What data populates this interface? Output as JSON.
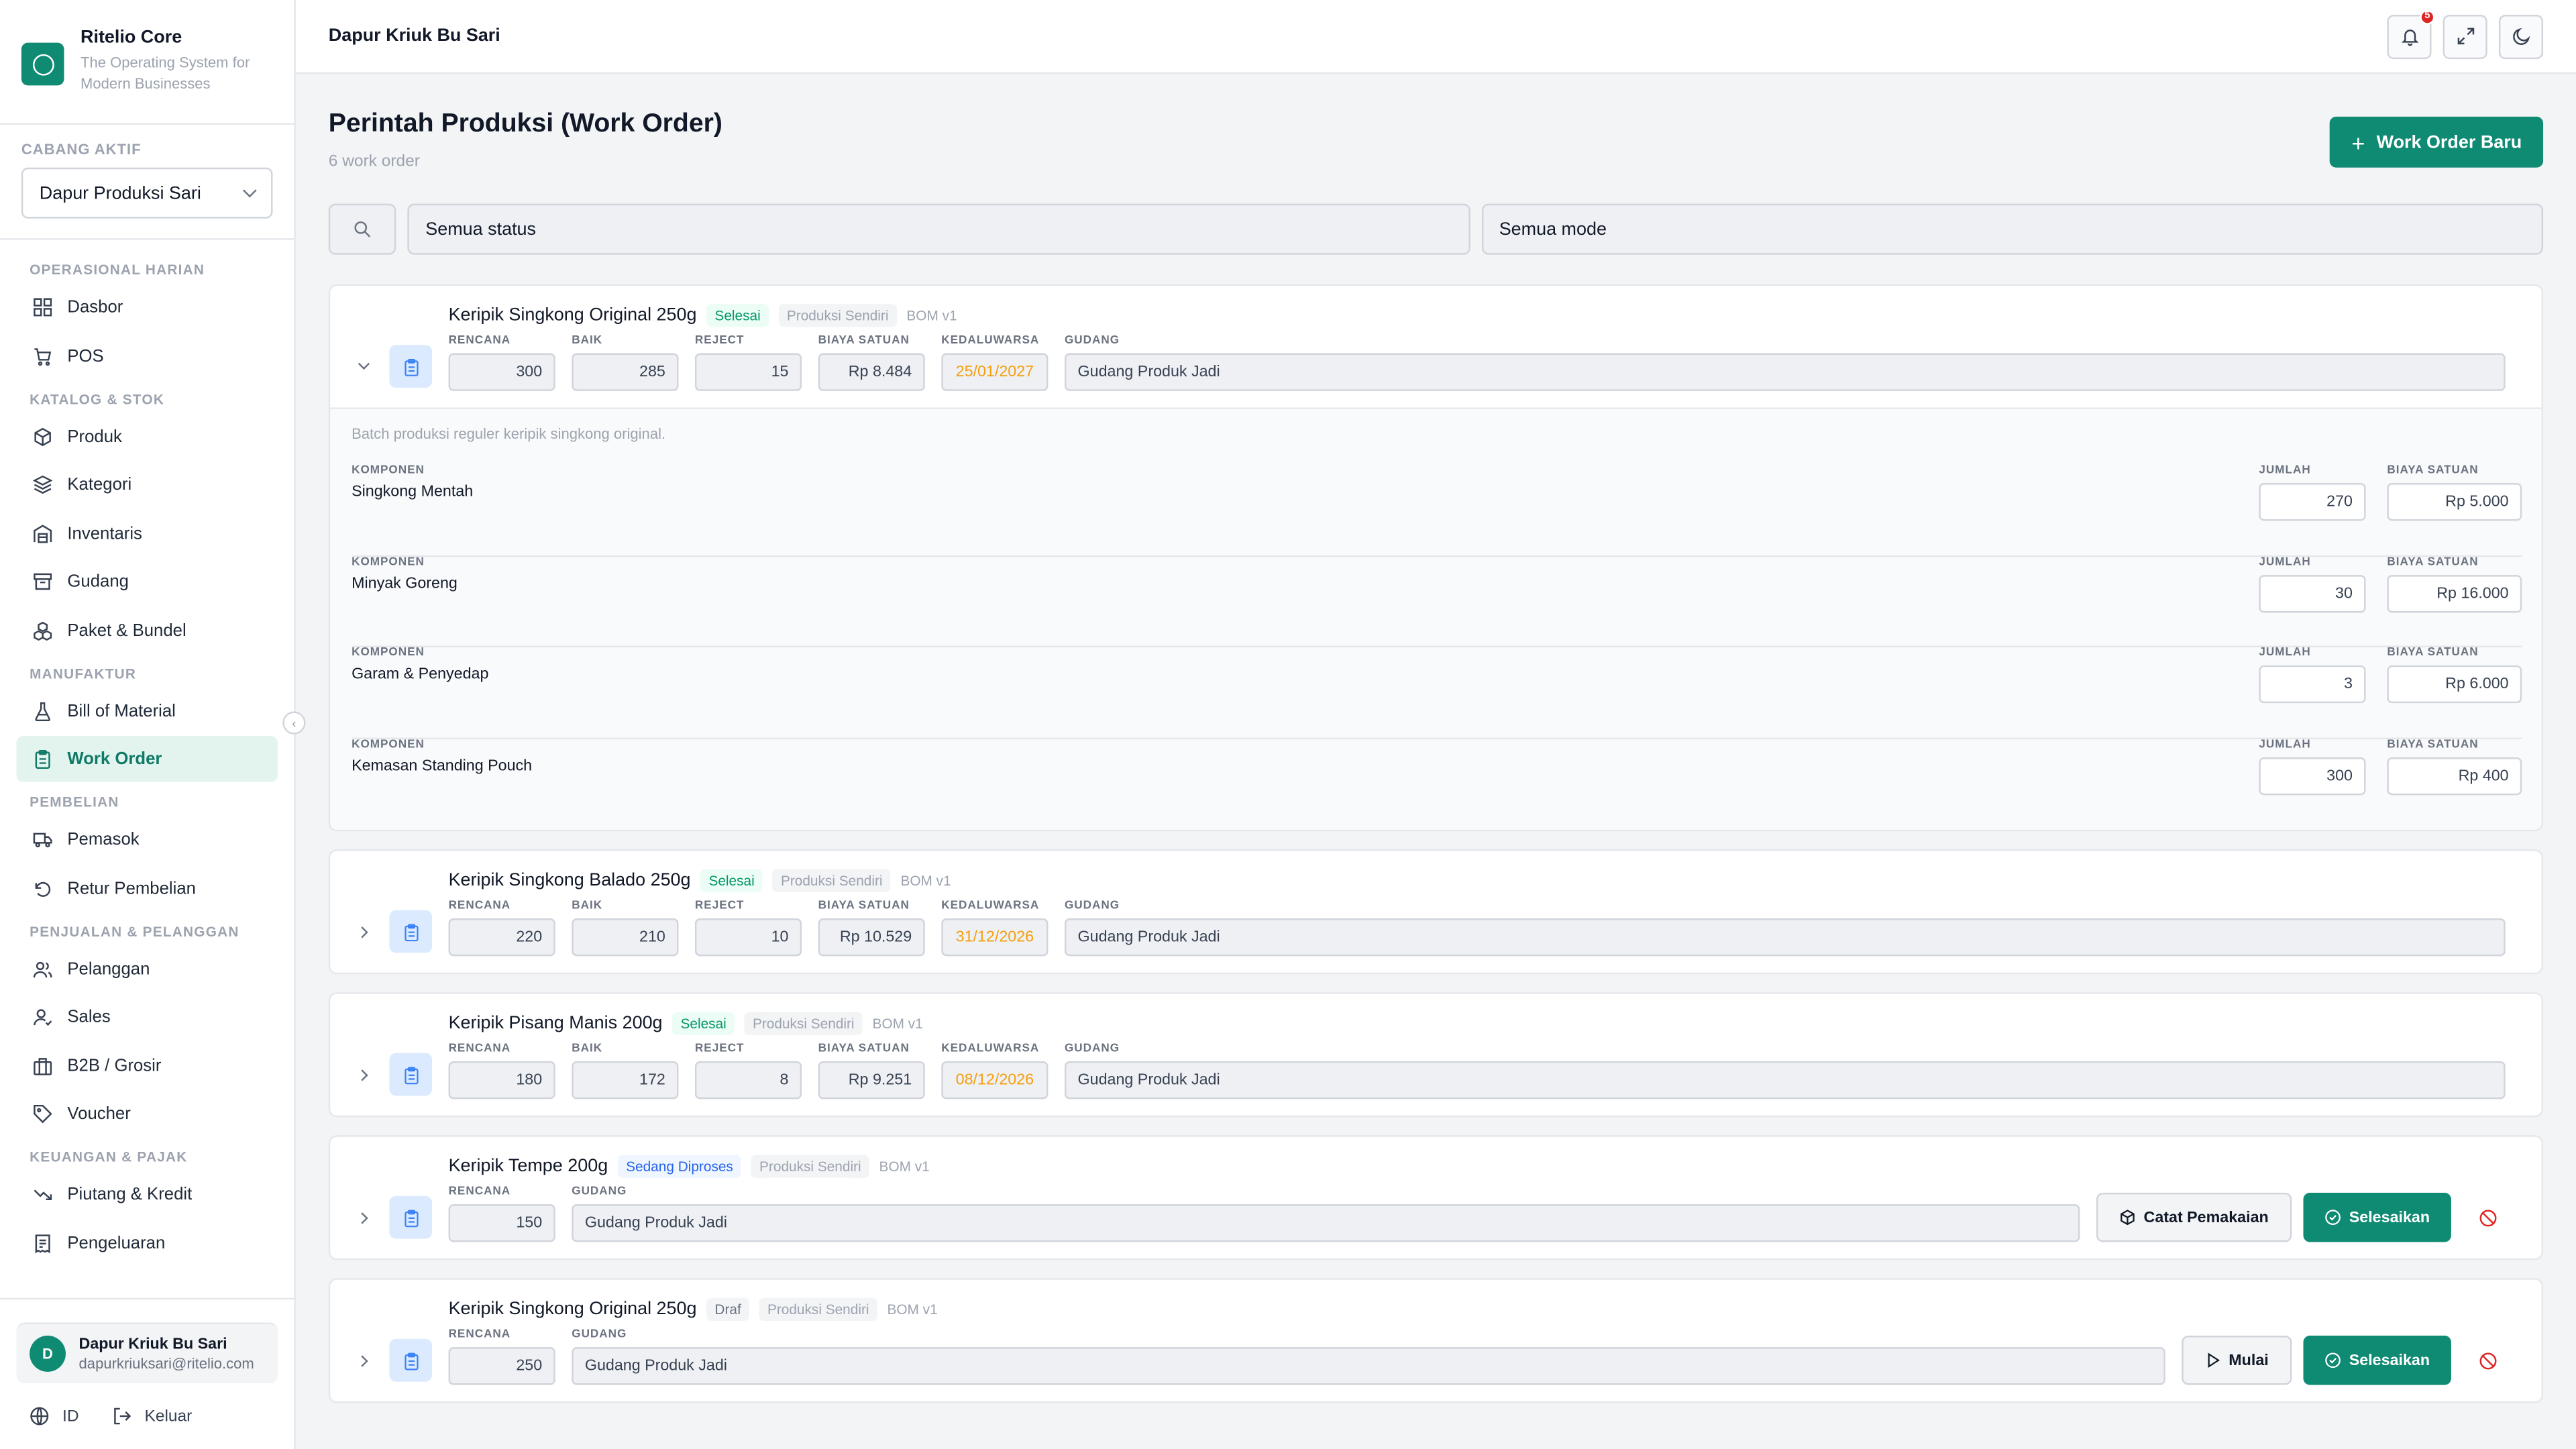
{
  "brand": {
    "name": "Ritelio Core",
    "tagline": "The Operating System for Modern Businesses"
  },
  "branch": {
    "label": "CABANG AKTIF",
    "value": "Dapur Produksi Sari"
  },
  "nav": {
    "sections": [
      {
        "label": "OPERASIONAL HARIAN",
        "items": [
          {
            "label": "Dasbor",
            "icon": "dashboard-icon"
          },
          {
            "label": "POS",
            "icon": "cart-icon"
          }
        ]
      },
      {
        "label": "KATALOG & STOK",
        "items": [
          {
            "label": "Produk",
            "icon": "box-icon"
          },
          {
            "label": "Kategori",
            "icon": "layers-icon"
          },
          {
            "label": "Inventaris",
            "icon": "warehouse-icon"
          },
          {
            "label": "Gudang",
            "icon": "archive-icon"
          },
          {
            "label": "Paket & Bundel",
            "icon": "boxes-icon"
          }
        ]
      },
      {
        "label": "MANUFAKTUR",
        "items": [
          {
            "label": "Bill of Material",
            "icon": "flask-icon"
          },
          {
            "label": "Work Order",
            "icon": "clipboard-icon",
            "active": true
          }
        ]
      },
      {
        "label": "PEMBELIAN",
        "items": [
          {
            "label": "Pemasok",
            "icon": "truck-icon"
          },
          {
            "label": "Retur Pembelian",
            "icon": "undo-icon"
          }
        ]
      },
      {
        "label": "PENJUALAN & PELANGGAN",
        "items": [
          {
            "label": "Pelanggan",
            "icon": "users-icon"
          },
          {
            "label": "Sales",
            "icon": "user-check-icon"
          },
          {
            "label": "B2B / Grosir",
            "icon": "building-icon"
          },
          {
            "label": "Voucher",
            "icon": "tag-icon"
          }
        ]
      },
      {
        "label": "KEUANGAN & PAJAK",
        "items": [
          {
            "label": "Piutang & Kredit",
            "icon": "trend-down-icon"
          },
          {
            "label": "Pengeluaran",
            "icon": "receipt-icon"
          }
        ]
      }
    ]
  },
  "user": {
    "initial": "D",
    "name": "Dapur Kriuk Bu Sari",
    "email": "dapurkriuksari@ritelio.com"
  },
  "footer": {
    "lang": "ID",
    "logout": "Keluar"
  },
  "topbar": {
    "title": "Dapur Kriuk Bu Sari",
    "notif_count": "5"
  },
  "page": {
    "title": "Perintah Produksi (Work Order)",
    "subtitle": "6 work order",
    "new_button": "Work Order Baru"
  },
  "filters": {
    "status": "Semua status",
    "mode": "Semua mode"
  },
  "labels": {
    "plan": "RENCANA",
    "good": "BAIK",
    "reject": "REJECT",
    "unit_cost": "BIAYA SATUAN",
    "expiry": "KEDALUWARSA",
    "warehouse": "GUDANG",
    "component": "KOMPONEN",
    "qty": "JUMLAH",
    "record_usage": "Catat Pemakaian",
    "finish": "Selesaikan",
    "start": "Mulai"
  },
  "work_orders": [
    {
      "name": "Keripik Singkong Original 250g",
      "status": "Selesai",
      "mode": "Produksi Sendiri",
      "bom": "BOM v1",
      "plan": "300",
      "good": "285",
      "reject": "15",
      "unit_cost": "Rp 8.484",
      "expiry": "25/01/2027",
      "warehouse": "Gudang Produk Jadi",
      "note": "Batch produksi reguler keripik singkong original.",
      "components": [
        {
          "name": "Singkong Mentah",
          "qty": "270",
          "cost": "Rp 5.000"
        },
        {
          "name": "Minyak Goreng",
          "qty": "30",
          "cost": "Rp 16.000"
        },
        {
          "name": "Garam & Penyedap",
          "qty": "3",
          "cost": "Rp 6.000"
        },
        {
          "name": "Kemasan Standing Pouch",
          "qty": "300",
          "cost": "Rp 400"
        }
      ]
    },
    {
      "name": "Keripik Singkong Balado 250g",
      "status": "Selesai",
      "mode": "Produksi Sendiri",
      "bom": "BOM v1",
      "plan": "220",
      "good": "210",
      "reject": "10",
      "unit_cost": "Rp 10.529",
      "expiry": "31/12/2026",
      "warehouse": "Gudang Produk Jadi"
    },
    {
      "name": "Keripik Pisang Manis 200g",
      "status": "Selesai",
      "mode": "Produksi Sendiri",
      "bom": "BOM v1",
      "plan": "180",
      "good": "172",
      "reject": "8",
      "unit_cost": "Rp 9.251",
      "expiry": "08/12/2026",
      "warehouse": "Gudang Produk Jadi"
    },
    {
      "name": "Keripik Tempe 200g",
      "status": "Sedang Diproses",
      "mode": "Produksi Sendiri",
      "bom": "BOM v1",
      "plan": "150",
      "warehouse": "Gudang Produk Jadi"
    },
    {
      "name": "Keripik Singkong Original 250g",
      "status": "Draf",
      "mode": "Produksi Sendiri",
      "bom": "BOM v1",
      "plan": "250",
      "warehouse": "Gudang Produk Jadi"
    }
  ]
}
